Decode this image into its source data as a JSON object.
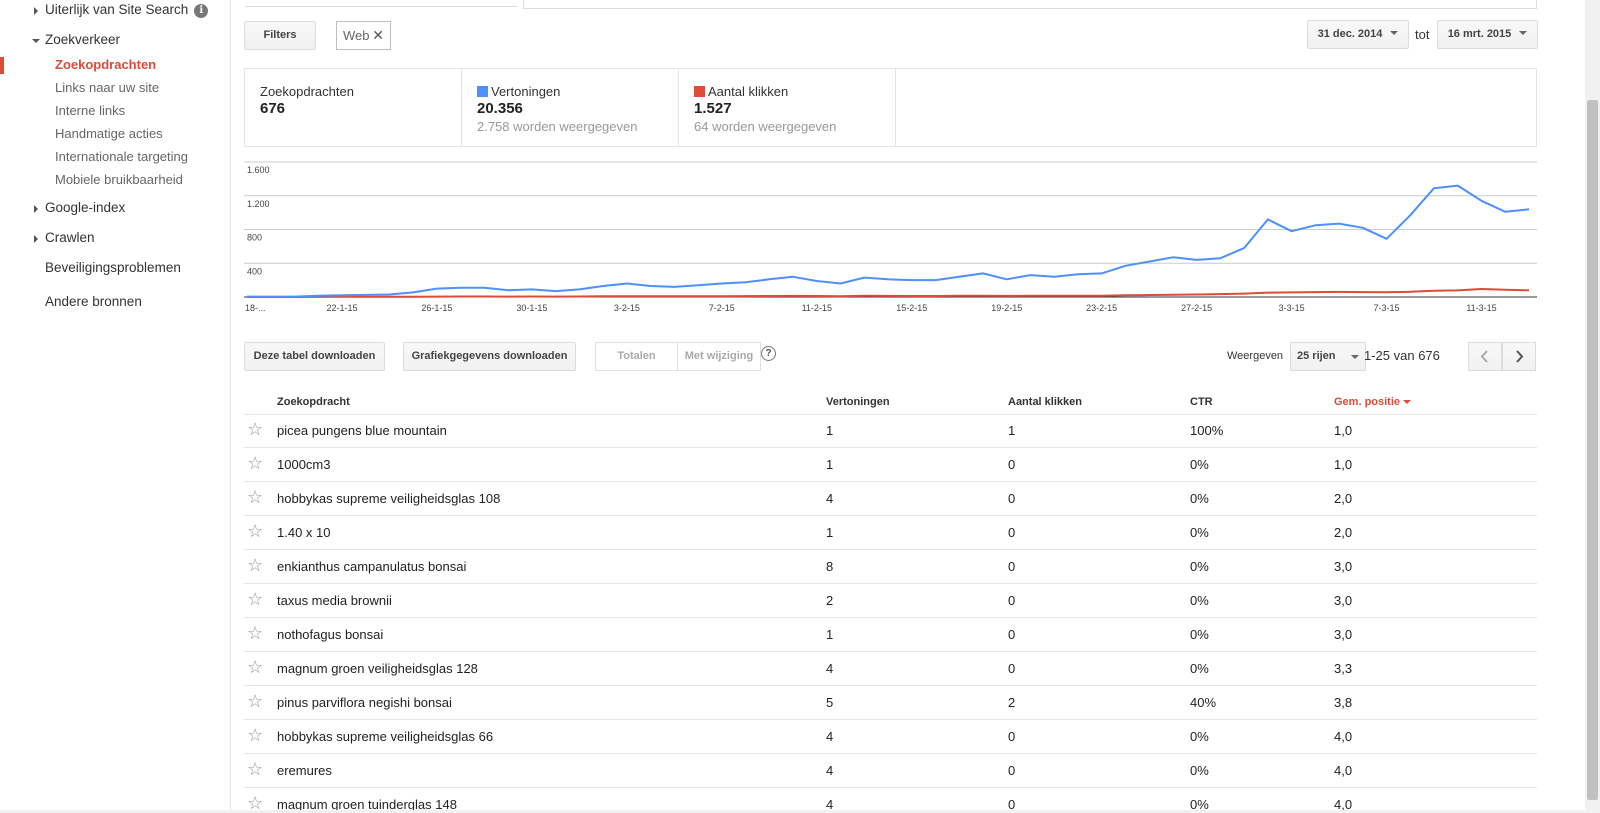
{
  "sidebar": {
    "items": [
      {
        "label": "Uiterlijk van Site Search",
        "level": "top",
        "expander": "collapsed",
        "info": "i"
      },
      {
        "label": "Zoekverkeer",
        "level": "top",
        "expander": "expanded"
      },
      {
        "label": "Zoekopdrachten",
        "level": "sub",
        "active": true
      },
      {
        "label": "Links naar uw site",
        "level": "sub"
      },
      {
        "label": "Interne links",
        "level": "sub"
      },
      {
        "label": "Handmatige acties",
        "level": "sub"
      },
      {
        "label": "Internationale targeting",
        "level": "sub"
      },
      {
        "label": "Mobiele bruikbaarheid",
        "level": "sub"
      },
      {
        "label": "Google-index",
        "level": "top",
        "expander": "collapsed"
      },
      {
        "label": "Crawlen",
        "level": "top",
        "expander": "collapsed"
      },
      {
        "label": "Beveiligingsproblemen",
        "level": "top"
      },
      {
        "label": "Andere bronnen",
        "level": "top"
      }
    ]
  },
  "toolbar": {
    "filters_label": "Filters",
    "filter_chip": "Web",
    "filter_chip_remove": "✕",
    "date_from": "31 dec. 2014",
    "date_to_label": "tot",
    "date_to": "16 mrt. 2015"
  },
  "cards": [
    {
      "label": "Zoekopdrachten",
      "value": "676",
      "sub": ""
    },
    {
      "label": "Vertoningen",
      "value": "20.356",
      "sub": "2.758 worden weergegeven",
      "color": "#4d90fe"
    },
    {
      "label": "Aantal klikken",
      "value": "1.527",
      "sub": "64 worden weergegeven",
      "color": "#dd4b39"
    }
  ],
  "chart_data": {
    "type": "line",
    "x": [
      "18-1-15",
      "19-1-15",
      "20-1-15",
      "21-1-15",
      "22-1-15",
      "23-1-15",
      "24-1-15",
      "25-1-15",
      "26-1-15",
      "27-1-15",
      "28-1-15",
      "29-1-15",
      "30-1-15",
      "31-1-15",
      "1-2-15",
      "2-2-15",
      "3-2-15",
      "4-2-15",
      "5-2-15",
      "6-2-15",
      "7-2-15",
      "8-2-15",
      "9-2-15",
      "10-2-15",
      "11-2-15",
      "12-2-15",
      "13-2-15",
      "14-2-15",
      "15-2-15",
      "16-2-15",
      "17-2-15",
      "18-2-15",
      "19-2-15",
      "20-2-15",
      "21-2-15",
      "22-2-15",
      "23-2-15",
      "24-2-15",
      "25-2-15",
      "26-2-15",
      "27-2-15",
      "28-2-15",
      "1-3-15",
      "2-3-15",
      "3-3-15",
      "4-3-15",
      "5-3-15",
      "6-3-15",
      "7-3-15",
      "8-3-15",
      "9-3-15",
      "10-3-15",
      "11-3-15",
      "12-3-15",
      "13-3-15"
    ],
    "x_tick_labels": [
      "18-...",
      "22-1-15",
      "26-1-15",
      "30-1-15",
      "3-2-15",
      "7-2-15",
      "11-2-15",
      "15-2-15",
      "19-2-15",
      "23-2-15",
      "27-2-15",
      "3-3-15",
      "7-3-15",
      "11-3-15"
    ],
    "ylim": [
      0,
      1600
    ],
    "y_ticks": [
      "400",
      "800",
      "1.200",
      "1.600"
    ],
    "grid": true,
    "series": [
      {
        "name": "Vertoningen",
        "color": "#4d90fe",
        "values": [
          5,
          5,
          5,
          15,
          20,
          25,
          30,
          55,
          100,
          110,
          110,
          80,
          90,
          70,
          90,
          130,
          160,
          130,
          120,
          140,
          160,
          175,
          210,
          240,
          190,
          160,
          230,
          210,
          200,
          200,
          240,
          280,
          210,
          260,
          240,
          270,
          280,
          370,
          420,
          470,
          440,
          460,
          580,
          920,
          780,
          850,
          870,
          820,
          690,
          970,
          1290,
          1320,
          1140,
          1010,
          1040
        ]
      },
      {
        "name": "Aantal klikken",
        "color": "#dd4b39",
        "values": [
          0,
          0,
          0,
          1,
          2,
          2,
          3,
          4,
          5,
          6,
          6,
          5,
          6,
          5,
          6,
          8,
          9,
          8,
          8,
          9,
          10,
          11,
          12,
          13,
          12,
          10,
          14,
          13,
          12,
          12,
          14,
          16,
          13,
          15,
          14,
          16,
          16,
          20,
          24,
          26,
          30,
          34,
          40,
          52,
          55,
          58,
          60,
          58,
          56,
          62,
          75,
          78,
          95,
          85,
          80
        ]
      }
    ]
  },
  "controls": {
    "download_table": "Deze tabel downloaden",
    "download_chart": "Grafiekgegevens downloaden",
    "totals": "Totalen",
    "with_change": "Met wijziging",
    "help": "?",
    "show_label": "Weergeven",
    "rows_select": "25 rijen",
    "pager": "1-25 van 676"
  },
  "table": {
    "columns": {
      "query": "Zoekopdracht",
      "impressions": "Vertoningen",
      "clicks": "Aantal klikken",
      "ctr": "CTR",
      "position": "Gem. positie"
    },
    "rows": [
      {
        "query": "picea pungens blue mountain",
        "impressions": "1",
        "clicks": "1",
        "ctr": "100%",
        "position": "1,0"
      },
      {
        "query": "1000cm3",
        "impressions": "1",
        "clicks": "0",
        "ctr": "0%",
        "position": "1,0"
      },
      {
        "query": "hobbykas supreme veiligheidsglas 108",
        "impressions": "4",
        "clicks": "0",
        "ctr": "0%",
        "position": "2,0"
      },
      {
        "query": "1.40 x 10",
        "impressions": "1",
        "clicks": "0",
        "ctr": "0%",
        "position": "2,0"
      },
      {
        "query": "enkianthus campanulatus bonsai",
        "impressions": "8",
        "clicks": "0",
        "ctr": "0%",
        "position": "3,0"
      },
      {
        "query": "taxus media brownii",
        "impressions": "2",
        "clicks": "0",
        "ctr": "0%",
        "position": "3,0"
      },
      {
        "query": "nothofagus bonsai",
        "impressions": "1",
        "clicks": "0",
        "ctr": "0%",
        "position": "3,0"
      },
      {
        "query": "magnum groen veiligheidsglas 128",
        "impressions": "4",
        "clicks": "0",
        "ctr": "0%",
        "position": "3,3"
      },
      {
        "query": "pinus parviflora negishi bonsai",
        "impressions": "5",
        "clicks": "2",
        "ctr": "40%",
        "position": "3,8"
      },
      {
        "query": "hobbykas supreme veiligheidsglas 66",
        "impressions": "4",
        "clicks": "0",
        "ctr": "0%",
        "position": "4,0"
      },
      {
        "query": "eremures",
        "impressions": "4",
        "clicks": "0",
        "ctr": "0%",
        "position": "4,0"
      },
      {
        "query": "magnum groen tuinderglas 148",
        "impressions": "4",
        "clicks": "0",
        "ctr": "0%",
        "position": "4,0"
      }
    ]
  }
}
